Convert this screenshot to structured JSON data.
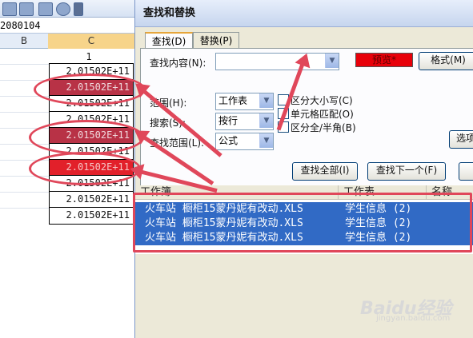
{
  "formula_bar": {
    "value": "2080104"
  },
  "columns": {
    "b": "B",
    "c": "C"
  },
  "cells": [
    {
      "value": "1"
    },
    {
      "value": "2.01502E+11"
    },
    {
      "value": "2.01502E+11"
    },
    {
      "value": "2.01502E+11"
    },
    {
      "value": "2.01502E+11"
    },
    {
      "value": "2.01502E+11"
    },
    {
      "value": "2.01502E+11"
    },
    {
      "value": "2.01502E+11"
    },
    {
      "value": "2.01502E+11"
    },
    {
      "value": "2.01502E+11"
    },
    {
      "value": "2.01502E+11"
    }
  ],
  "dialog": {
    "title": "查找和替换",
    "tabs": [
      {
        "label": "查找(D)"
      },
      {
        "label": "替换(P)"
      }
    ],
    "find_what_label": "查找内容(N):",
    "find_what_value": "",
    "preview_label": "预览*",
    "format_button": "格式(M)",
    "within_label": "范围(H):",
    "within_value": "工作表",
    "search_label": "搜索(S):",
    "search_value": "按行",
    "lookin_label": "查找范围(L):",
    "lookin_value": "公式",
    "match_case_label": "区分大小写(C)",
    "match_cell_label": "单元格匹配(O)",
    "match_byte_label": "区分全/半角(B)",
    "options_button": "选项",
    "find_all_button": "查找全部(I)",
    "find_next_button": "查找下一个(F)",
    "results": {
      "headers": [
        "工作簿",
        "工作表",
        "名称"
      ],
      "rows": [
        {
          "book": "火车站 橱柜15蒙丹妮有改动.XLS",
          "sheet": "学生信息 (2)"
        },
        {
          "book": "火车站 橱柜15蒙丹妮有改动.XLS",
          "sheet": "学生信息 (2)"
        },
        {
          "book": "火车站 橱柜15蒙丹妮有改动.XLS",
          "sheet": "学生信息 (2)"
        }
      ]
    }
  },
  "colors": {
    "highlight": "#b83246",
    "highlight_bright": "#e2202a",
    "annotation": "#e0475a",
    "selection": "#316ac5"
  },
  "watermark": {
    "text": "Baidu经验",
    "sub": "jingyan.baidu.com"
  }
}
